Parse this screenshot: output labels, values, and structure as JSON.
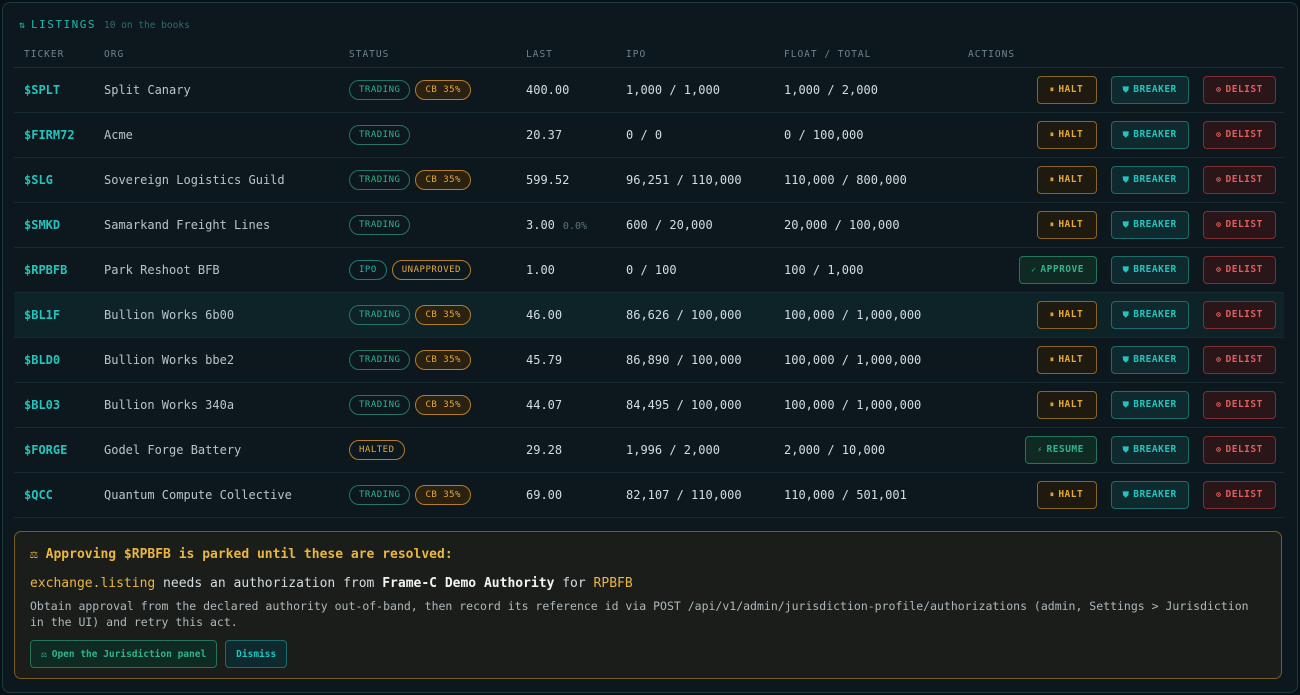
{
  "header": {
    "icon": "market-icon",
    "title": "LISTINGS",
    "subtitle": "10 on the books"
  },
  "columns": [
    "TICKER",
    "ORG",
    "STATUS",
    "LAST",
    "IPO",
    "FLOAT / TOTAL",
    "ACTIONS"
  ],
  "rows": [
    {
      "ticker": "$SPLT",
      "org": "Split Canary",
      "status": [
        "TRADING",
        "CB 35%"
      ],
      "last": "400.00",
      "chg": "",
      "ipo": "1,000 / 1,000",
      "float": "1,000 / 2,000",
      "primary": "HALT"
    },
    {
      "ticker": "$FIRM72",
      "org": "Acme",
      "status": [
        "TRADING"
      ],
      "last": "20.37",
      "chg": "",
      "ipo": "0 / 0",
      "float": "0 / 100,000",
      "primary": "HALT"
    },
    {
      "ticker": "$SLG",
      "org": "Sovereign Logistics Guild",
      "status": [
        "TRADING",
        "CB 35%"
      ],
      "last": "599.52",
      "chg": "",
      "ipo": "96,251 / 110,000",
      "float": "110,000 / 800,000",
      "primary": "HALT"
    },
    {
      "ticker": "$SMKD",
      "org": "Samarkand Freight Lines",
      "status": [
        "TRADING"
      ],
      "last": "3.00",
      "chg": "0.0%",
      "ipo": "600 / 20,000",
      "float": "20,000 / 100,000",
      "primary": "HALT"
    },
    {
      "ticker": "$RPBFB",
      "org": "Park Reshoot BFB",
      "status": [
        "IPO",
        "UNAPPROVED"
      ],
      "last": "1.00",
      "chg": "",
      "ipo": "0 / 100",
      "float": "100 / 1,000",
      "primary": "APPROVE"
    },
    {
      "ticker": "$BL1F",
      "org": "Bullion Works 6b00",
      "status": [
        "TRADING",
        "CB 35%"
      ],
      "last": "46.00",
      "chg": "",
      "ipo": "86,626 / 100,000",
      "float": "100,000 / 1,000,000",
      "primary": "HALT"
    },
    {
      "ticker": "$BLD0",
      "org": "Bullion Works bbe2",
      "status": [
        "TRADING",
        "CB 35%"
      ],
      "last": "45.79",
      "chg": "",
      "ipo": "86,890 / 100,000",
      "float": "100,000 / 1,000,000",
      "primary": "HALT"
    },
    {
      "ticker": "$BL03",
      "org": "Bullion Works 340a",
      "status": [
        "TRADING",
        "CB 35%"
      ],
      "last": "44.07",
      "chg": "",
      "ipo": "84,495 / 100,000",
      "float": "100,000 / 1,000,000",
      "primary": "HALT"
    },
    {
      "ticker": "$FORGE",
      "org": "Godel Forge Battery",
      "status": [
        "HALTED"
      ],
      "last": "29.28",
      "chg": "",
      "ipo": "1,996 / 2,000",
      "float": "2,000 / 10,000",
      "primary": "RESUME"
    },
    {
      "ticker": "$QCC",
      "org": "Quantum Compute Collective",
      "status": [
        "TRADING",
        "CB 35%"
      ],
      "last": "69.00",
      "chg": "",
      "ipo": "82,107 / 110,000",
      "float": "110,000 / 501,001",
      "primary": "HALT"
    }
  ],
  "highlighted_row": 5,
  "actions": {
    "breaker": "BREAKER",
    "delist": "DELIST"
  },
  "notice": {
    "title": "Approving $RPBFB is parked until these are resolved:",
    "capability": "exchange.listing",
    "needs_text": " needs an authorization from ",
    "authority": "Frame-C Demo Authority",
    "for_text": " for ",
    "ticker": "RPBFB",
    "description": "Obtain approval from the declared authority out-of-band, then record its reference id via POST /api/v1/admin/jurisdiction-profile/authorizations (admin, Settings > Jurisdiction in the UI) and retry this act.",
    "open_button": "Open the Jurisdiction panel",
    "dismiss_button": "Dismiss"
  },
  "colors": {
    "accent": "#1fb7b0",
    "warning": "#e7a83a",
    "danger": "#e25d5d",
    "success": "#2fb488"
  }
}
